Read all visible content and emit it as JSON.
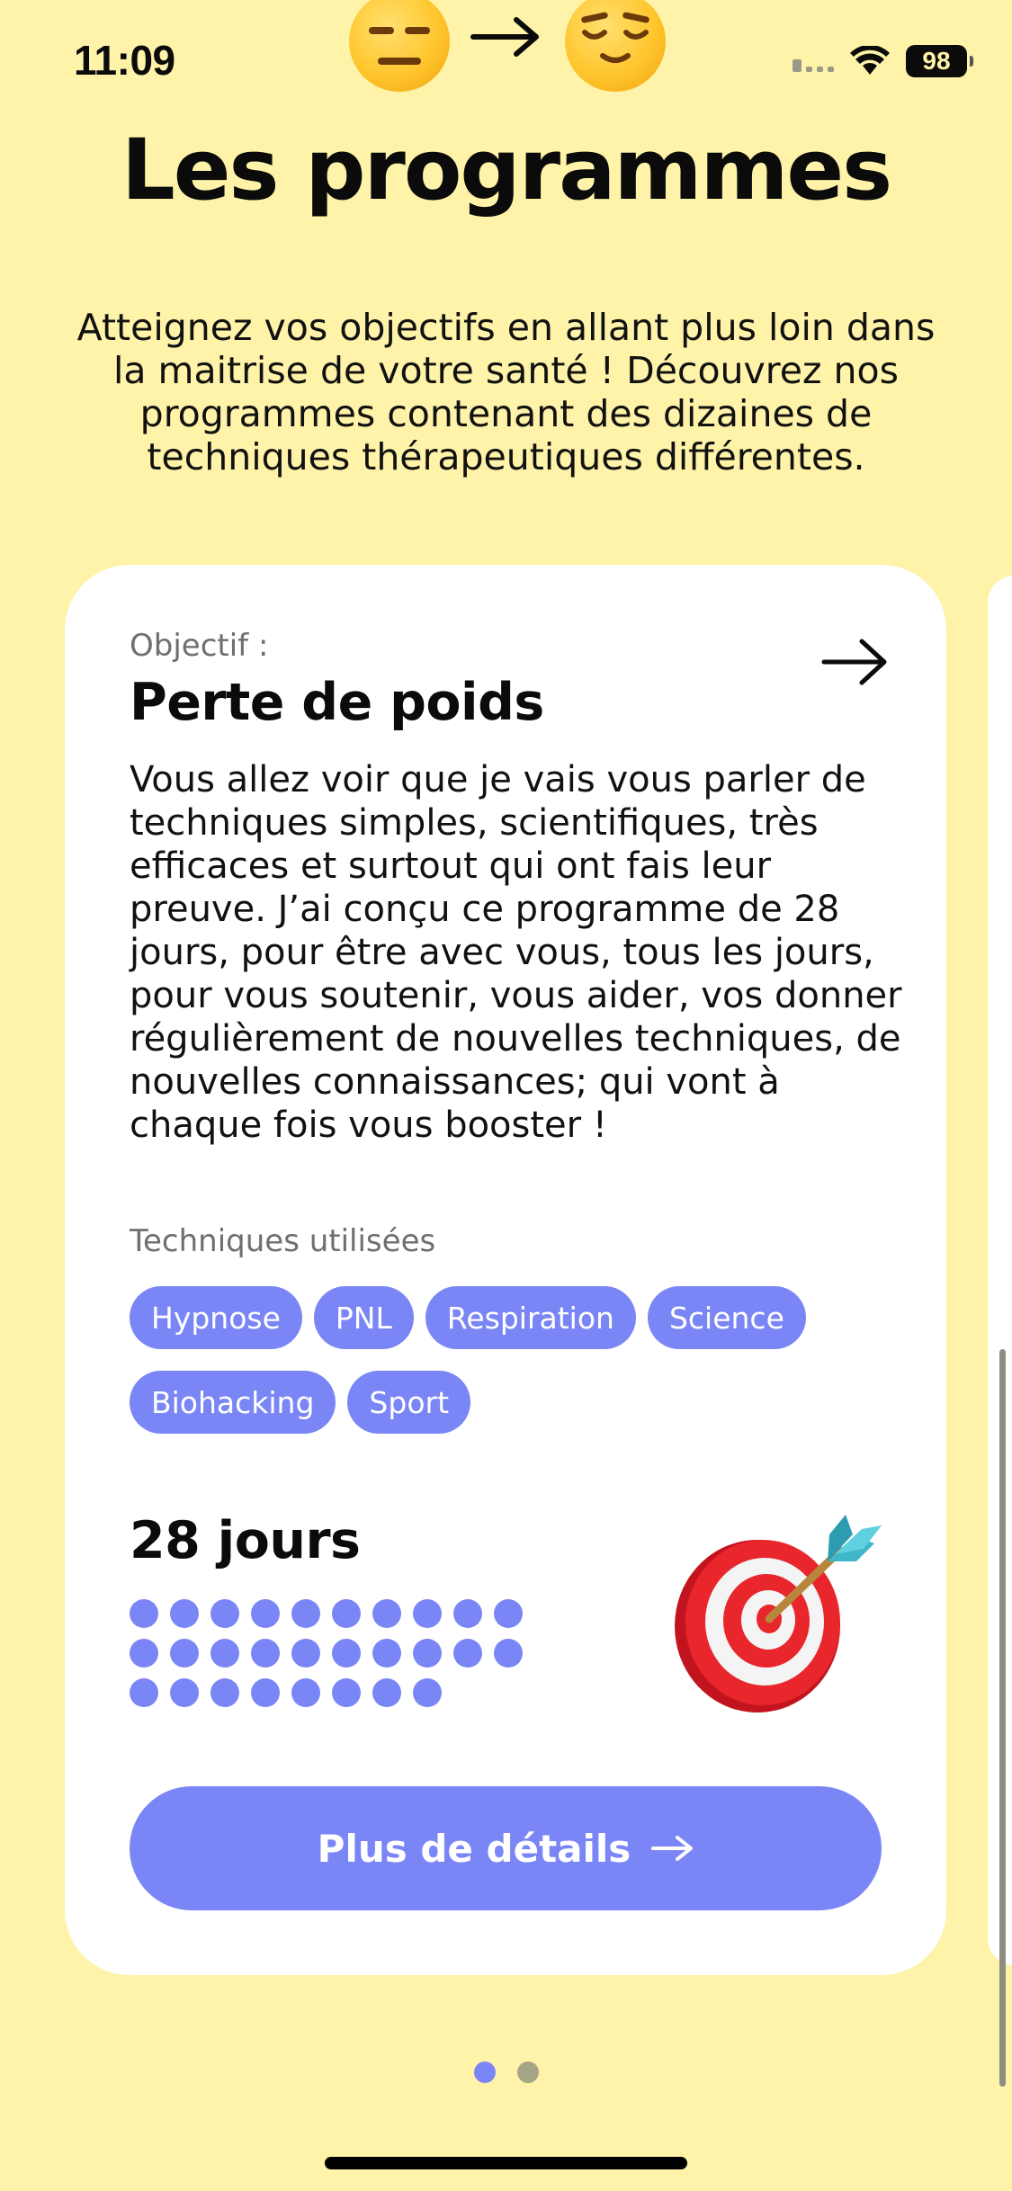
{
  "status_bar": {
    "time": "11:09",
    "battery": "98"
  },
  "header": {
    "title": "Les programmes",
    "intro": "Atteignez vos objectifs en allant plus loin dans la maitrise de votre santé ! Découvrez nos programmes contenant des dizaines de techniques thérapeutiques différentes."
  },
  "program_card": {
    "label": "Objectif :",
    "title": "Perte de poids",
    "description": "Vous allez voir que je vais vous parler de techniques simples, scientifiques, très efficaces et surtout qui ont fais leur preuve. J’ai conçu ce programme de 28 jours, pour être avec vous, tous les jours, pour vous soutenir, vous aider, vos donner régulièrement de nouvelles techniques, de nouvelles connaissances; qui vont à chaque fois vous booster !",
    "techniques_label": "Techniques utilisées",
    "techniques": [
      "Hypnose",
      "PNL",
      "Respiration",
      "Science",
      "Biohacking",
      "Sport"
    ],
    "duration": "28 jours",
    "day_count": 28,
    "button_label": "Plus de détails"
  },
  "pager": {
    "pages": 2,
    "current": 0
  },
  "colors": {
    "background": "#FEF3A8",
    "accent": "#7B86F6",
    "pager_inactive": "#A5A58A"
  },
  "icons": {
    "header_emoji": [
      "expressionless-face-icon",
      "arrow-right-icon",
      "relieved-face-icon"
    ],
    "card_illustration": "direct-hit-target-icon"
  }
}
